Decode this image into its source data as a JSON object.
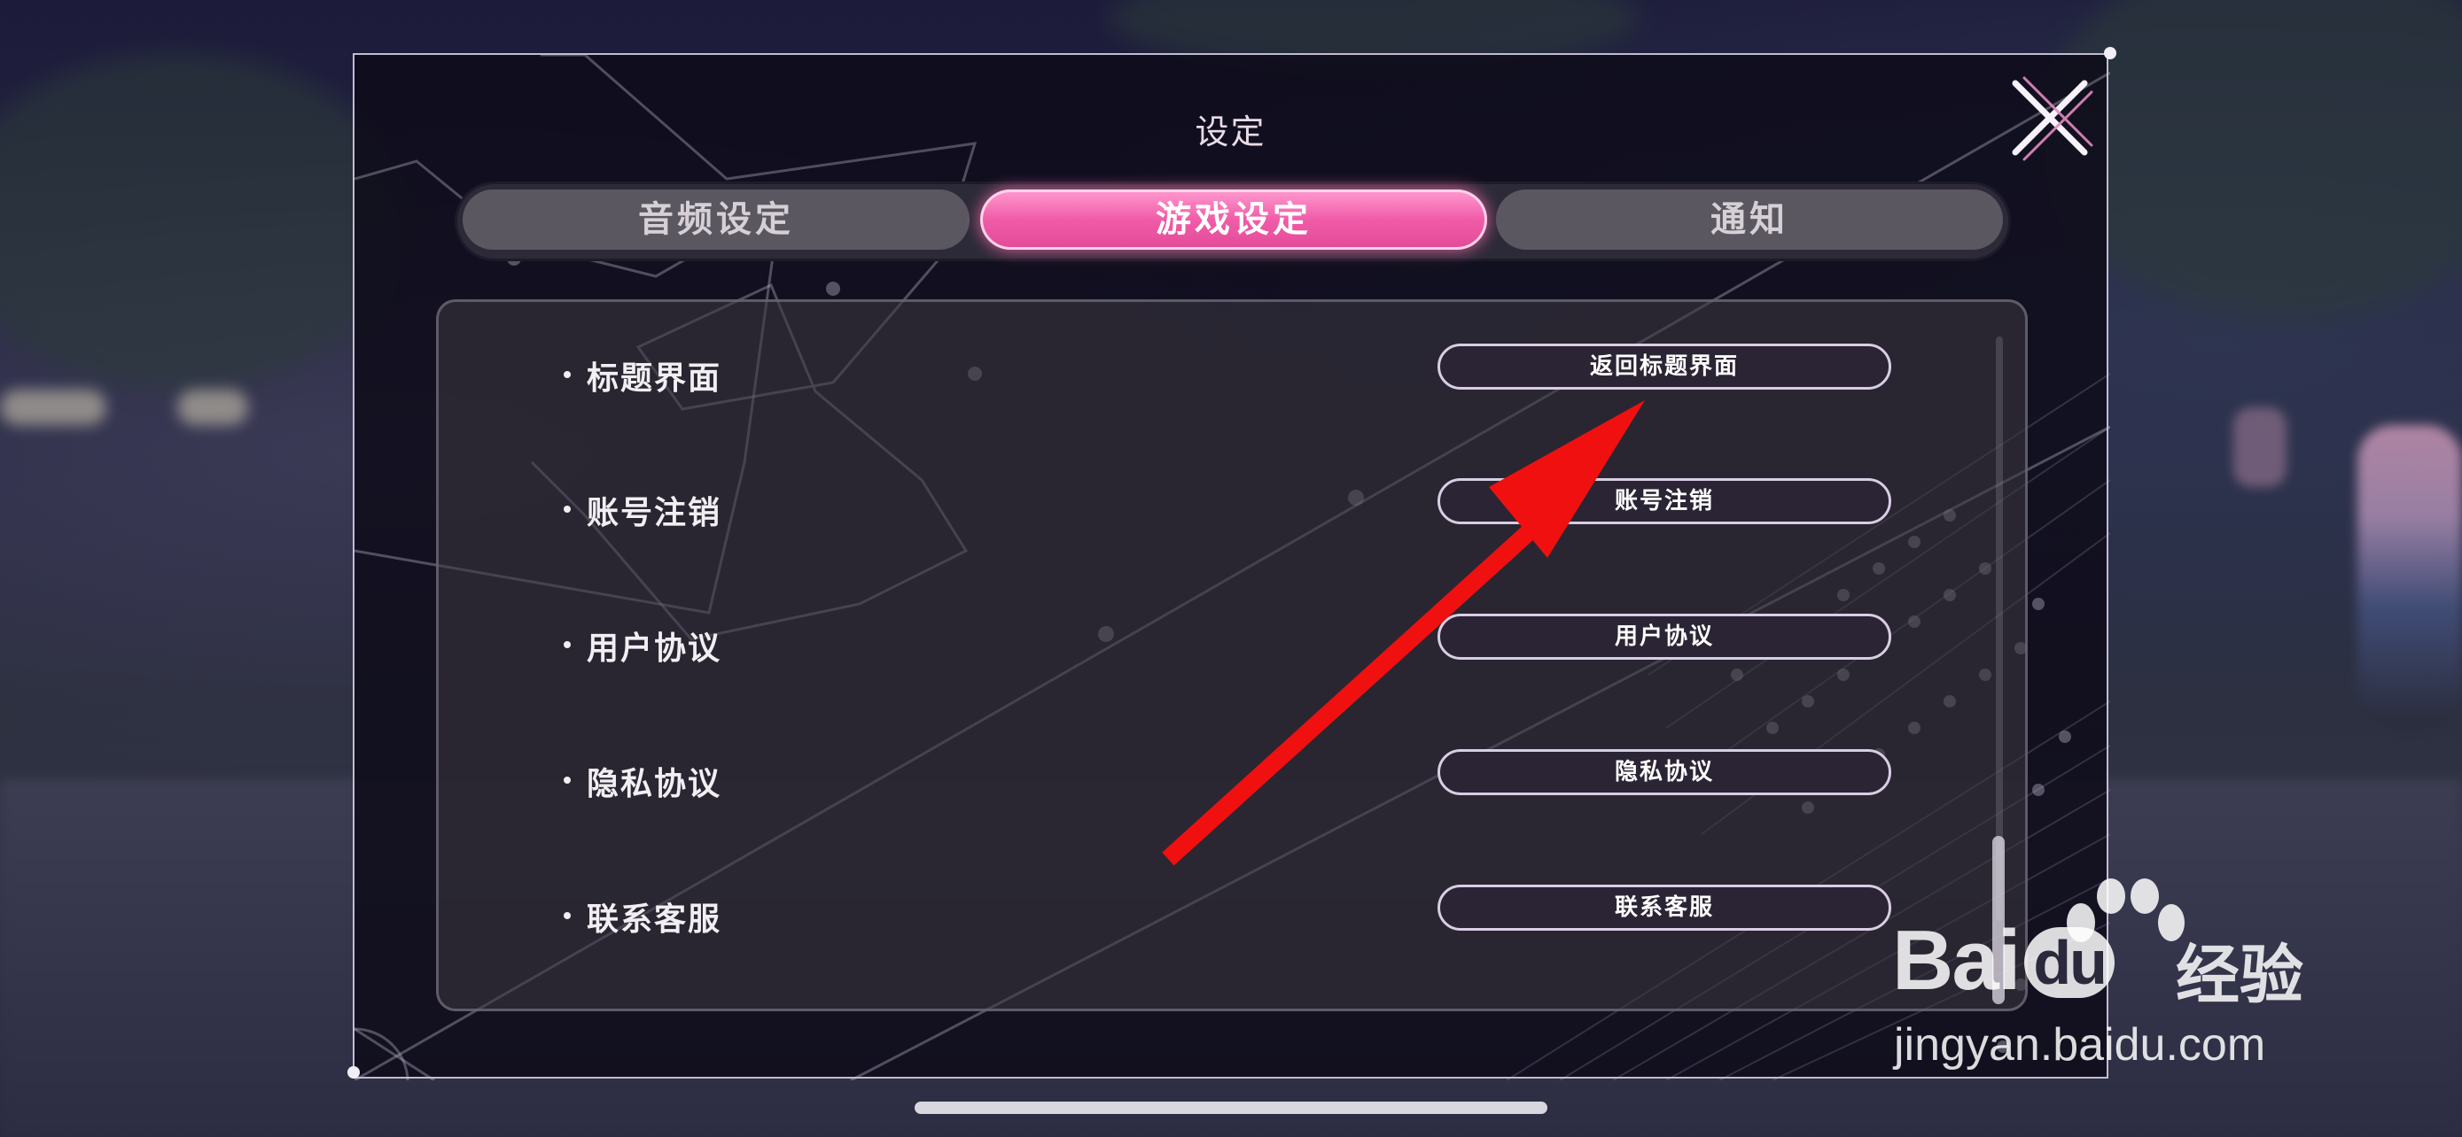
{
  "dialog": {
    "title": "设定",
    "close_icon": "close-x-icon"
  },
  "tabs": [
    {
      "label": "音频设定",
      "active": false
    },
    {
      "label": "游戏设定",
      "active": true
    },
    {
      "label": "通知",
      "active": false
    }
  ],
  "rows": [
    {
      "label": "标题界面",
      "button": "返回标题界面"
    },
    {
      "label": "账号注销",
      "button": "账号注销"
    },
    {
      "label": "用户协议",
      "button": "用户协议"
    },
    {
      "label": "隐私协议",
      "button": "隐私协议"
    },
    {
      "label": "联系客服",
      "button": "联系客服"
    }
  ],
  "watermark": {
    "brand_latin_1": "Bai",
    "brand_latin_2": "du",
    "brand_cn": "经验",
    "url": "jingyan.baidu.com"
  },
  "colors": {
    "active_tab": "#f05ca8",
    "annotation_arrow": "#ff0000"
  }
}
